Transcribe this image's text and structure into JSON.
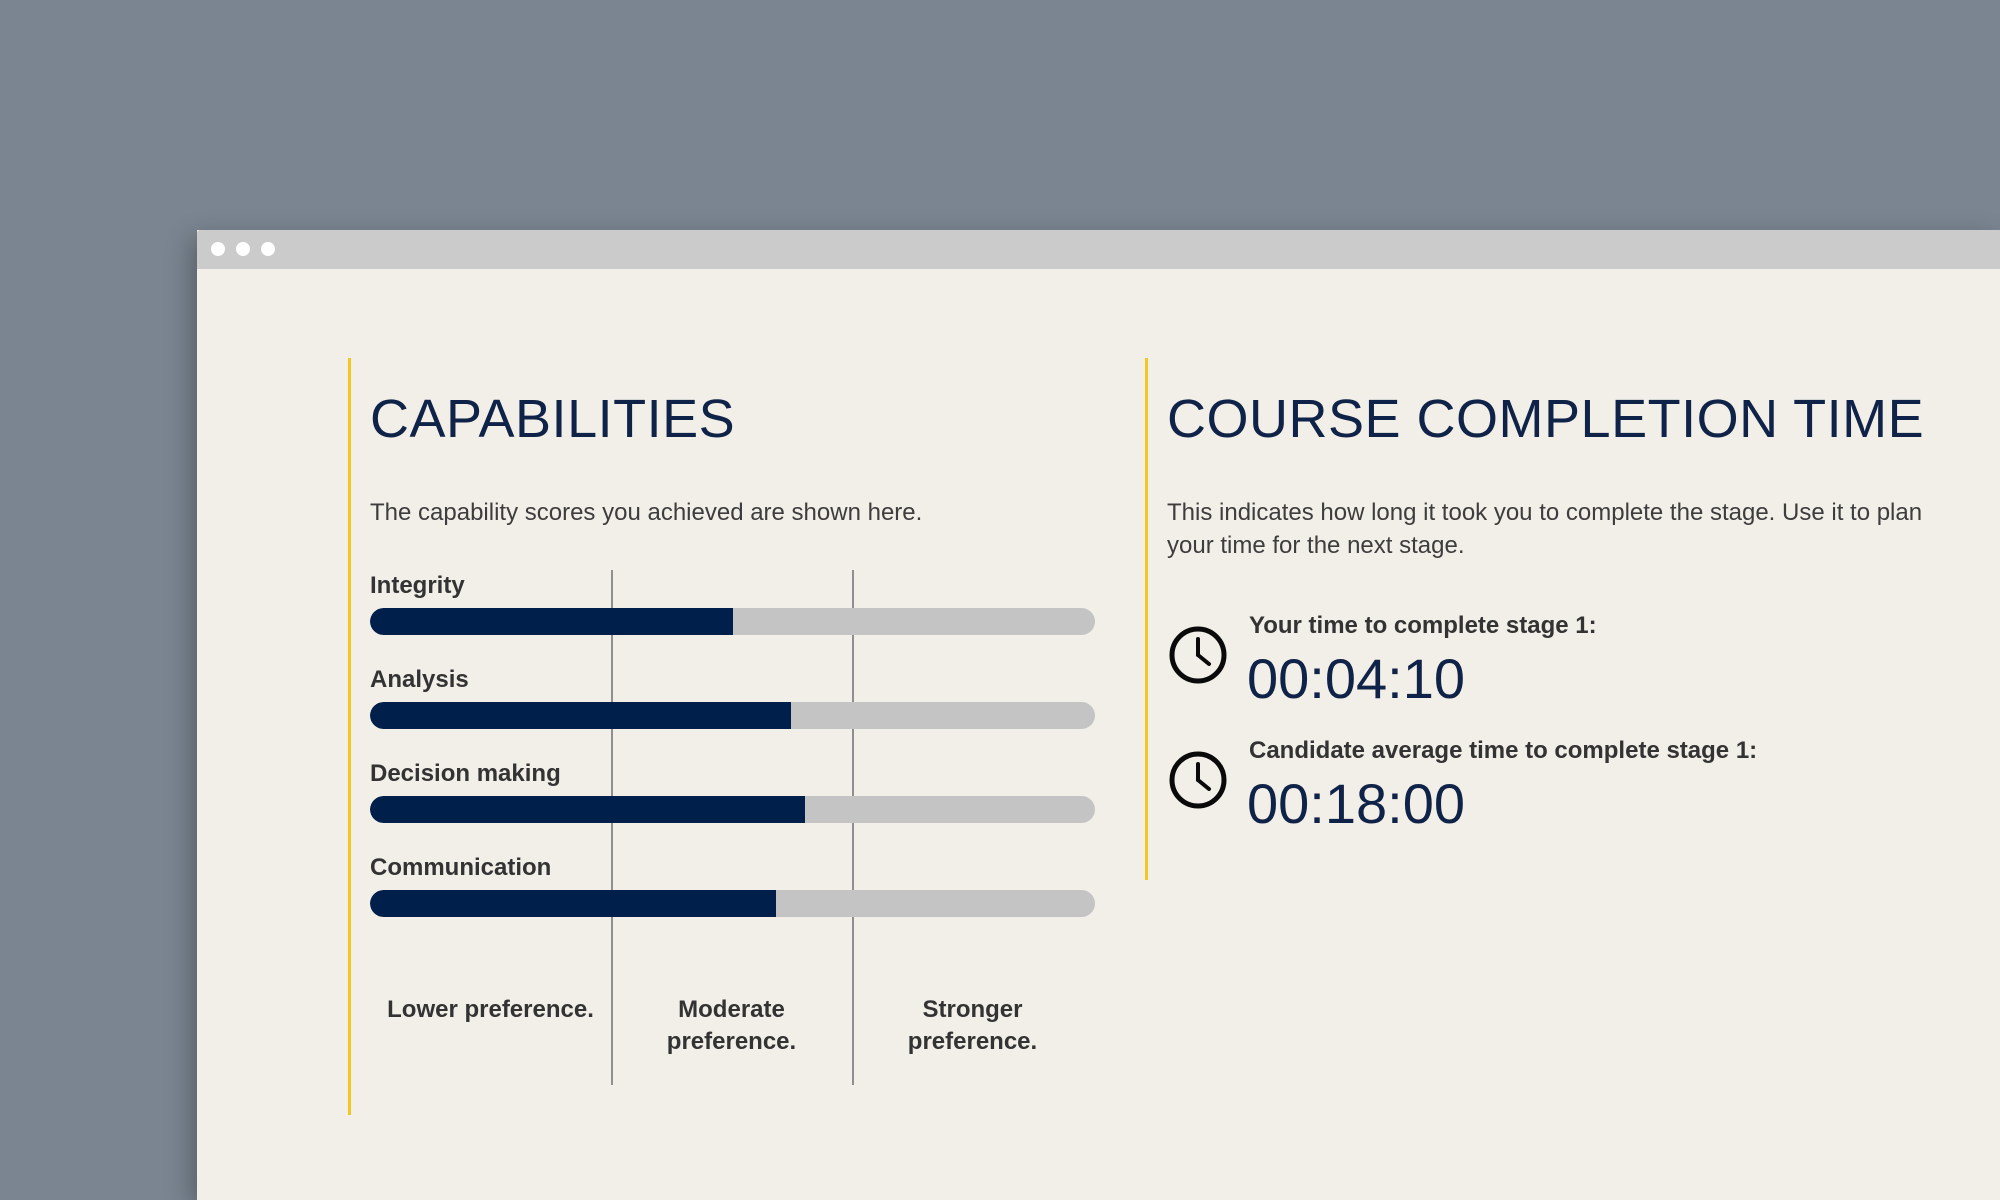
{
  "window": {
    "controls": [
      "close",
      "minimize",
      "maximize"
    ]
  },
  "capabilities": {
    "title": "CAPABILITIES",
    "description": "The capability scores you achieved are shown here.",
    "items": [
      {
        "label": "Integrity",
        "score": 0.5
      },
      {
        "label": "Analysis",
        "score": 0.58
      },
      {
        "label": "Decision making",
        "score": 0.6
      },
      {
        "label": "Communication",
        "score": 0.56
      }
    ],
    "preferences": [
      "Lower preference.",
      "Moderate preference.",
      "Stronger preference."
    ],
    "colors": {
      "fill": "#001f4a",
      "track": "#c4c4c4",
      "accent": "#f2c623"
    }
  },
  "completion": {
    "title": "COURSE COMPLETION TIME",
    "description": "This indicates how long it took you to complete the stage. Use it to plan your time for the next stage.",
    "times": [
      {
        "label": "Your time to complete stage 1:",
        "value": "00:04:10",
        "icon": "clock-icon"
      },
      {
        "label": "Candidate average time to complete stage 1:",
        "value": "00:18:00",
        "icon": "clock-icon"
      }
    ]
  }
}
